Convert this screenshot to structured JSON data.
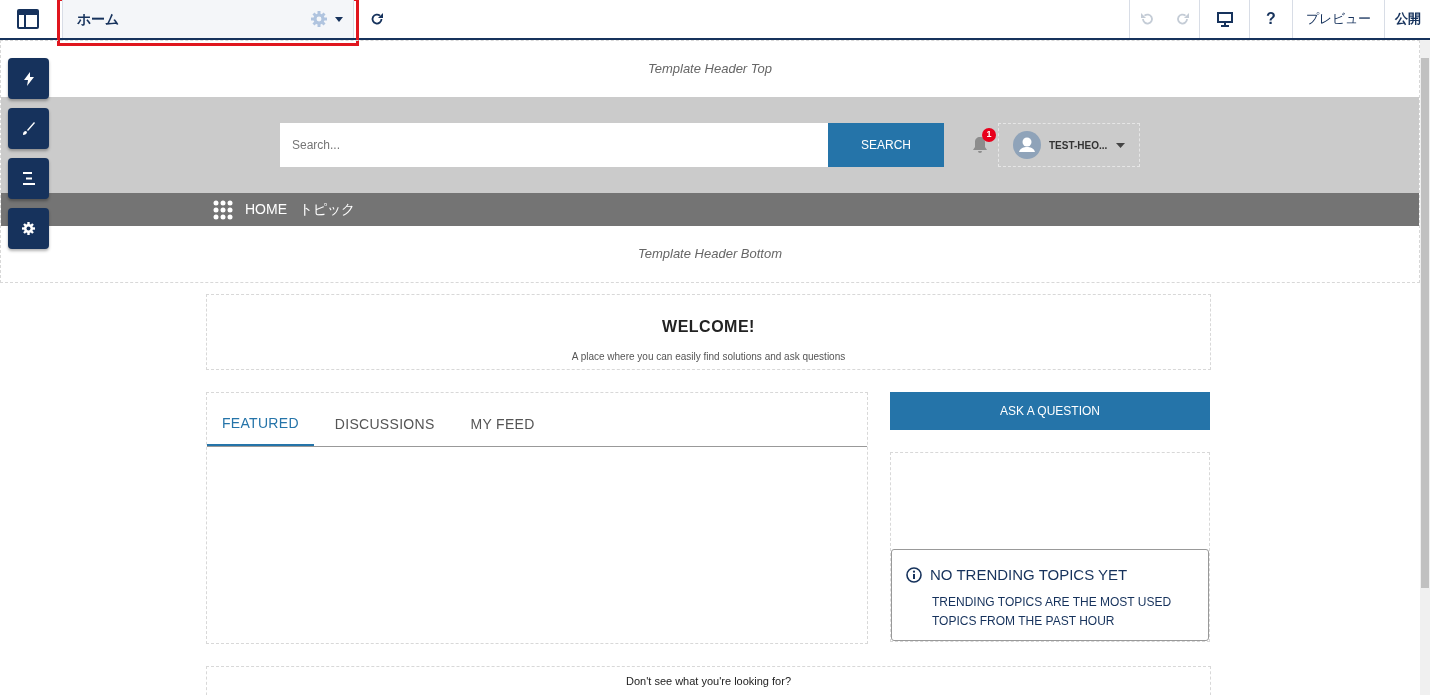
{
  "toolbar": {
    "page_selector": {
      "label": "ホーム"
    },
    "undo": {
      "disabled": true
    },
    "redo": {
      "disabled": true
    },
    "help": "?",
    "preview": "プレビュー",
    "publish": "公開"
  },
  "side_buttons": [
    {
      "kind": "bolt"
    },
    {
      "kind": "brush"
    },
    {
      "kind": "list"
    },
    {
      "kind": "gear"
    }
  ],
  "header": {
    "top_label": "Template Header Top",
    "search": {
      "placeholder": "Search...",
      "button": "SEARCH"
    },
    "notifications": {
      "count": "1"
    },
    "user": {
      "name": "TEST-HEO..."
    },
    "nav": [
      "HOME",
      "トピック"
    ],
    "bottom_label": "Template Header Bottom"
  },
  "welcome": {
    "title": "WELCOME!",
    "subtitle": "A place where you can easily find solutions and ask questions"
  },
  "tabs": [
    {
      "label": "FEATURED",
      "selected": true
    },
    {
      "label": "DISCUSSIONS",
      "selected": false
    },
    {
      "label": "MY FEED",
      "selected": false
    }
  ],
  "ask_button": "ASK A QUESTION",
  "trending": {
    "title": "NO TRENDING TOPICS YET",
    "message": "TRENDING TOPICS ARE THE MOST USED TOPICS FROM THE PAST HOUR"
  },
  "footer": {
    "text": "Don't see what you're looking for?"
  }
}
